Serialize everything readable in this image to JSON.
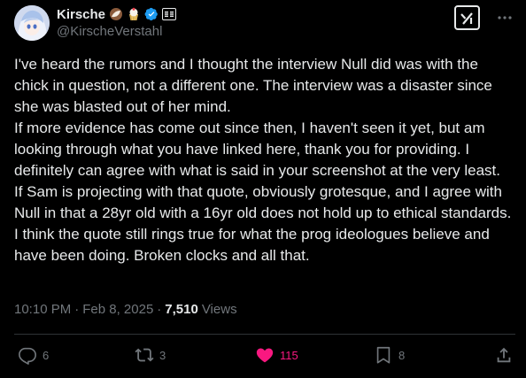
{
  "author": {
    "display_name": "Kirsche",
    "handle": "@KirscheVerstahl",
    "verified": true
  },
  "header": {
    "grok_icon": "grok-icon",
    "more_icon": "more-icon"
  },
  "tweet": {
    "paragraphs": [
      "I've heard the rumors and I thought the interview Null did was with the chick in question, not a different one. The interview was a disaster since she was blasted out of her mind.",
      "If more evidence has come out since then, I haven't seen it yet, but am looking through what you have linked here, thank you for providing. I definitely can agree with what is said in your screenshot at the very least.",
      "If Sam is projecting with that quote, obviously grotesque, and I agree with Null in that a 28yr old with a 16yr old does not hold up to ethical standards. I think the quote still rings true for what the prog ideologues believe and have been doing. Broken clocks and all that."
    ]
  },
  "meta": {
    "time": "10:10 PM",
    "separator": "·",
    "date": "Feb 8, 2025",
    "views_count": "7,510",
    "views_label": "Views"
  },
  "actions": {
    "replies": "6",
    "reposts": "3",
    "likes": "115",
    "bookmarks": "8"
  },
  "colors": {
    "background": "#000000",
    "text": "#e7e9ea",
    "muted": "#71767b",
    "like": "#f91880",
    "verified": "#1d9bf0",
    "divider": "#2f3336"
  }
}
